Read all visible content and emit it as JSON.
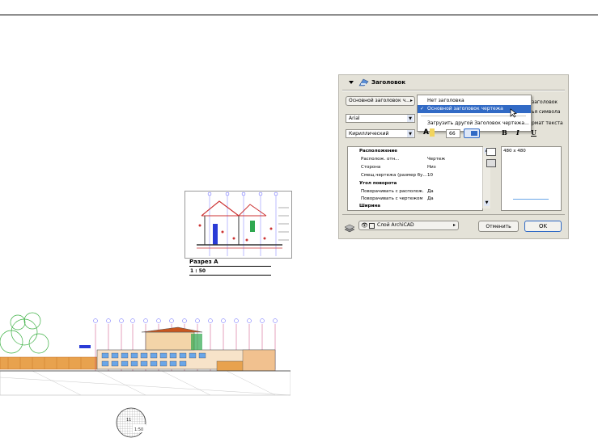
{
  "section": {
    "title": "Разрез А",
    "scale": "1 : 50"
  },
  "scale_marker": {
    "number": "11",
    "scale": "1:50"
  },
  "dialog": {
    "header_title": "Заголовок",
    "title_type_dropdown": "Основной заголовок ч...",
    "menu_items": [
      "Нет заголовка",
      "Основной заголовок чертежа",
      "Загрузить другой Заголовок чертежа..."
    ],
    "selected_item_index": 1,
    "side_labels": [
      "заголовок",
      "ья символа",
      "рмат текста"
    ],
    "font_dropdown": "Arial",
    "charset_dropdown": "Кириллический",
    "font_size_value": "66",
    "style_buttons": [
      "B",
      "I",
      "U"
    ],
    "properties": [
      {
        "label": "Расположение",
        "value": "",
        "bold": true
      },
      {
        "label": "Располож. отн...",
        "value": "Чертеж",
        "bold": false
      },
      {
        "label": "Сторона",
        "value": "Низ",
        "bold": false
      },
      {
        "label": "Смещ.чертежа (размер бу...",
        "value": "10",
        "bold": false
      },
      {
        "label": "Угол поворота",
        "value": "",
        "bold": true
      },
      {
        "label": "Поворачивать с располож.",
        "value": "Да",
        "bold": false
      },
      {
        "label": "Поворачивать с чертежом",
        "value": "Да",
        "bold": false
      },
      {
        "label": "Ширина",
        "value": "",
        "bold": true
      }
    ],
    "preview_size": "480 x 480",
    "layer_dropdown": "Слой ArchiCAD",
    "cancel_label": "Отменить",
    "ok_label": "OK",
    "accent_color": "#316ac5"
  }
}
